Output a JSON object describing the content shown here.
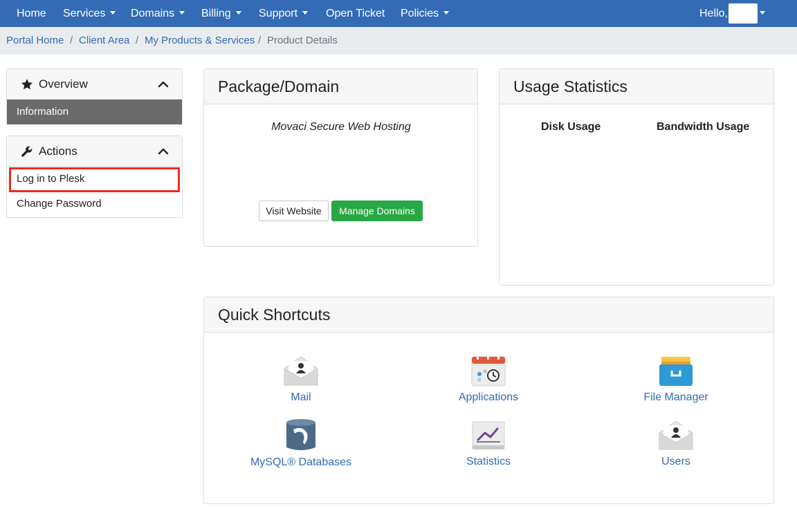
{
  "nav": {
    "items": [
      {
        "label": "Home",
        "dropdown": false
      },
      {
        "label": "Services",
        "dropdown": true
      },
      {
        "label": "Domains",
        "dropdown": true
      },
      {
        "label": "Billing",
        "dropdown": true
      },
      {
        "label": "Support",
        "dropdown": true
      },
      {
        "label": "Open Ticket",
        "dropdown": false
      },
      {
        "label": "Policies",
        "dropdown": true
      }
    ],
    "hello_label": "Hello,"
  },
  "breadcrumb": {
    "items": [
      "Portal Home",
      "Client Area",
      "My Products & Services"
    ],
    "current": "Product Details",
    "separator": "/"
  },
  "sidebar": {
    "overview": {
      "title": "Overview",
      "icon": "star-icon",
      "items": [
        {
          "label": "Information",
          "active": true
        }
      ]
    },
    "actions": {
      "title": "Actions",
      "icon": "wrench-icon",
      "items": [
        {
          "label": "Log in to Plesk",
          "highlighted": true
        },
        {
          "label": "Change Password"
        }
      ]
    }
  },
  "package": {
    "title": "Package/Domain",
    "product_name": "Movaci Secure Web Hosting",
    "visit_button": "Visit Website",
    "manage_button": "Manage Domains"
  },
  "usage": {
    "title": "Usage Statistics",
    "disk_label": "Disk Usage",
    "bandwidth_label": "Bandwidth Usage"
  },
  "shortcuts": {
    "title": "Quick Shortcuts",
    "items": [
      {
        "label": "Mail",
        "icon": "mail-icon"
      },
      {
        "label": "Applications",
        "icon": "applications-icon"
      },
      {
        "label": "File Manager",
        "icon": "file-manager-icon"
      },
      {
        "label": "MySQL® Databases",
        "icon": "database-icon"
      },
      {
        "label": "Statistics",
        "icon": "statistics-icon"
      },
      {
        "label": "Users",
        "icon": "users-icon"
      }
    ]
  },
  "colors": {
    "nav_bg": "#336bb5",
    "link": "#336bb5",
    "success": "#28a745",
    "active_item": "#6a6a6a",
    "highlight": "#ee2a1b"
  }
}
